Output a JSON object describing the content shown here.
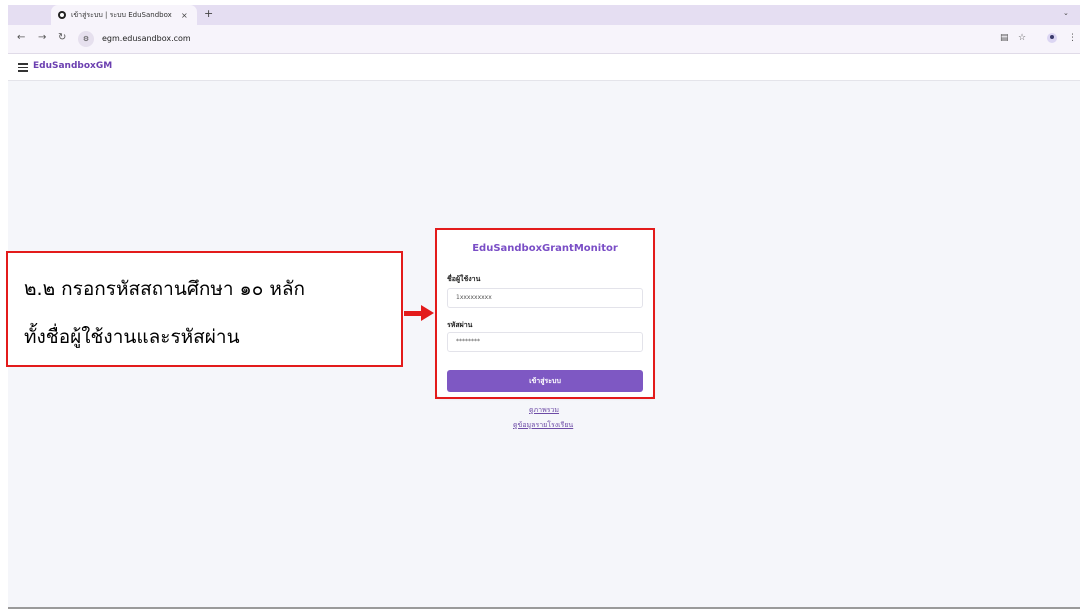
{
  "browser": {
    "tab_title": "เข้าสู่ระบบ | ระบบ EduSandbox",
    "tab_close": "×",
    "new_tab": "+",
    "tab_menu": "⌄",
    "url": "egm.edusandbox.com"
  },
  "app": {
    "brand": "EduSandboxGM"
  },
  "login": {
    "title": "EduSandboxGrantMonitor",
    "username_label": "ชื่อผู้ใช้งาน",
    "username_value": "1xxxxxxxxx",
    "password_label": "รหัสผ่าน",
    "password_value": "********",
    "submit_label": "เข้าสู่ระบบ"
  },
  "links": {
    "overview": "ดูภาพรวม",
    "school_data": "ดูข้อมูลรายโรงเรียน"
  },
  "annotation": {
    "line1": "๒.๒ กรอกรหัสสถานศึกษา ๑๐ หลัก",
    "line2": "ทั้งชื่อผู้ใช้งานและรหัสผ่าน"
  },
  "colors": {
    "brand": "#6b3fb0",
    "button": "#7e58c3",
    "annotation_red": "#e31b1b"
  }
}
